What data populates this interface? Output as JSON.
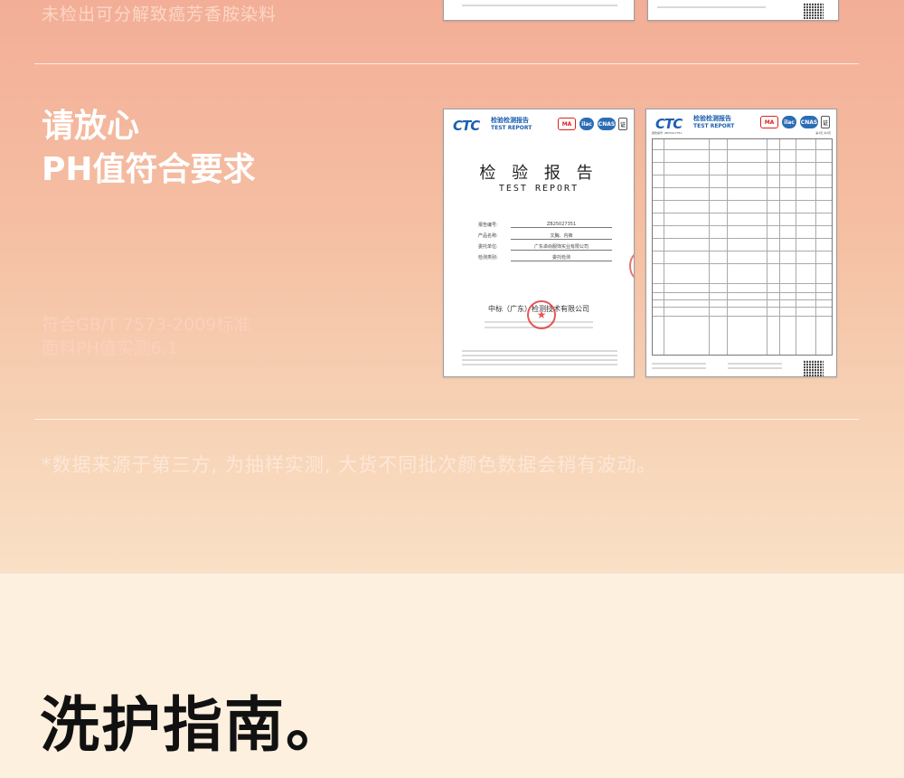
{
  "previous": {
    "subtitle": "未检出可分解致癌芳香胺染料"
  },
  "ph_section": {
    "headline_line1": "请放心",
    "headline_line2": "PH值符合要求",
    "spec_line1": "符合GB/T 7573-2009标准",
    "spec_line2": "面料PH值实测6.1"
  },
  "report": {
    "logo": "CTC",
    "logo_cn": "检验检测报告",
    "logo_en": "TEST REPORT",
    "badges": [
      "MA",
      "ilac",
      "CNAS",
      "证"
    ],
    "title_cn": "检 验 报 告",
    "title_en": "TEST REPORT",
    "fields": [
      {
        "label": "报告编号:",
        "value": "ZB25027351"
      },
      {
        "label": "产品名称:",
        "value": "文胸、内裤"
      },
      {
        "label": "委托单位:",
        "value": "广东卓尚服饰实业有限公司"
      },
      {
        "label": "检测类别:",
        "value": "委托检测"
      }
    ],
    "org_name": "中标（广东）检测技术有限公司",
    "seal_star": "★",
    "table_page": "第2页 共4页",
    "table_report_no": "报告编号: ZB25027351"
  },
  "disclaimer": "*数据来源于第三方, 为抽样实测, 大货不同批次颜色数据会稍有波动。",
  "care": {
    "title": "洗护指南。"
  }
}
